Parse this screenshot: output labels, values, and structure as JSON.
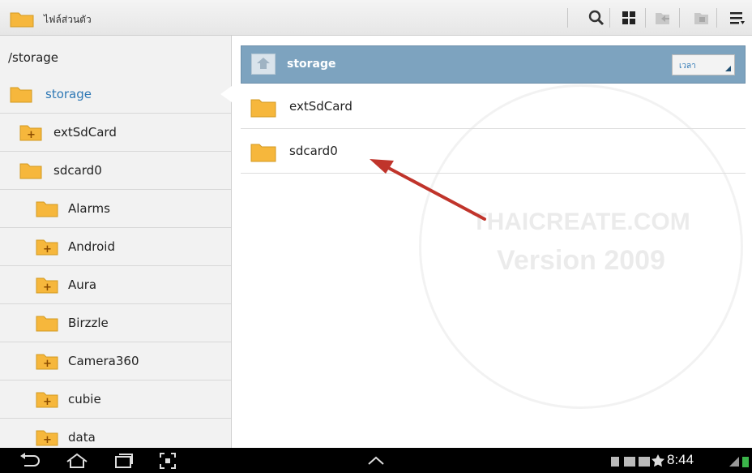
{
  "app": {
    "title": "ไฟล์ส่วนตัว"
  },
  "toolbar": {
    "icons": [
      "search-icon",
      "grid-view-icon",
      "move-icon",
      "copy-icon",
      "menu-icon"
    ]
  },
  "left_pane": {
    "path": "/storage",
    "items": [
      {
        "label": "storage",
        "icon": "folder-open",
        "selected": true
      },
      {
        "label": "extSdCard",
        "icon": "folder-plus"
      },
      {
        "label": "sdcard0",
        "icon": "folder-open"
      },
      {
        "label": "Alarms",
        "icon": "folder"
      },
      {
        "label": "Android",
        "icon": "folder-plus"
      },
      {
        "label": "Aura",
        "icon": "folder-plus"
      },
      {
        "label": "Birzzle",
        "icon": "folder"
      },
      {
        "label": "Camera360",
        "icon": "folder-plus"
      },
      {
        "label": "cubie",
        "icon": "folder-plus"
      },
      {
        "label": "data",
        "icon": "folder-plus"
      }
    ]
  },
  "right_pane": {
    "header_title": "storage",
    "sort_label": "เวลา",
    "watermark_line1": "THAICREATE.COM",
    "watermark_line2": "Version 2009",
    "items": [
      {
        "label": "extSdCard"
      },
      {
        "label": "sdcard0"
      }
    ]
  },
  "status": {
    "time": "8:44"
  },
  "colors": {
    "accent": "#2e78b5",
    "header": "#7da3bf",
    "folder": "#f6b73c",
    "arrow": "#c0342b"
  }
}
